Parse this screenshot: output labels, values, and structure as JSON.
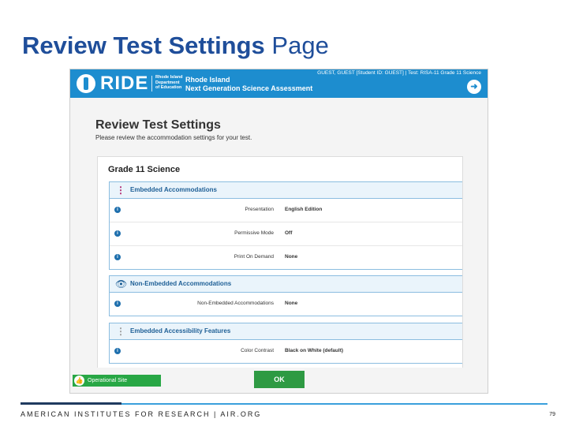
{
  "slide": {
    "title_bold": "Review Test Settings",
    "title_rest": "Page",
    "footer": "AMERICAN INSTITUTES FOR RESEARCH | AIR.ORG",
    "page_number": "79"
  },
  "app": {
    "logo": "RIDE",
    "logo_sub": "Rhode Island Department of Education",
    "assessment_line1": "Rhode Island",
    "assessment_line2": "Next Generation Science Assessment",
    "user_info": "GUEST, GUEST [Student ID: GUEST] | Test: RISA-11 Grade 11 Science",
    "logout_icon": "logout-icon",
    "header_color": "#1d8dcf"
  },
  "review": {
    "heading": "Review Test Settings",
    "subheading": "Please review the accommodation settings for your test.",
    "card_title": "Grade 11 Science",
    "sections": [
      {
        "title": "Embedded Accommodations",
        "icon": "⋮",
        "rows": [
          {
            "label": "Presentation",
            "value": "English Edition"
          },
          {
            "label": "Permissive Mode",
            "value": "Off"
          },
          {
            "label": "Print On Demand",
            "value": "None"
          }
        ]
      },
      {
        "title": "Non-Embedded Accommodations",
        "icon": "👁",
        "rows": [
          {
            "label": "Non-Embedded Accommodations",
            "value": "None"
          }
        ]
      },
      {
        "title": "Embedded Accessibility Features",
        "icon": "⋮",
        "rows": [
          {
            "label": "Color Contrast",
            "value": "Black on White (default)"
          }
        ]
      }
    ]
  },
  "bottom": {
    "operational_site": "Operational Site",
    "ok_label": "OK",
    "ok_color": "#2e9a43"
  }
}
